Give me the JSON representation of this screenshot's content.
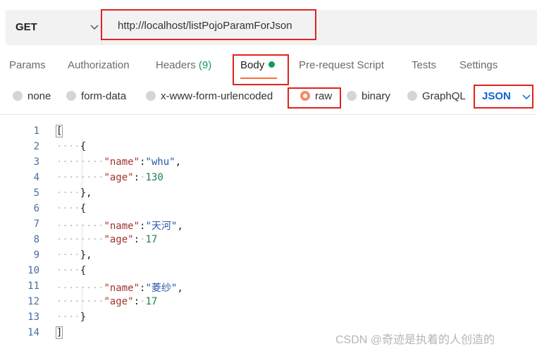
{
  "request": {
    "method": "GET",
    "url": "http://localhost/listPojoParamForJson"
  },
  "tabs": [
    {
      "label": "Params"
    },
    {
      "label": "Authorization"
    },
    {
      "label": "Headers",
      "count": "(9)"
    },
    {
      "label": "Body"
    },
    {
      "label": "Pre-request Script"
    },
    {
      "label": "Tests"
    },
    {
      "label": "Settings"
    }
  ],
  "body_types": [
    {
      "label": "none"
    },
    {
      "label": "form-data"
    },
    {
      "label": "x-www-form-urlencoded"
    },
    {
      "label": "raw"
    },
    {
      "label": "binary"
    },
    {
      "label": "GraphQL"
    }
  ],
  "format": "JSON",
  "code_lines": [
    "1",
    "2",
    "3",
    "4",
    "5",
    "6",
    "7",
    "8",
    "9",
    "10",
    "11",
    "12",
    "13",
    "14"
  ],
  "json_items": [
    {
      "name_key": "\"name\"",
      "name_value": "\"whu\"",
      "age_key": "\"age\"",
      "age_value": "130"
    },
    {
      "name_key": "\"name\"",
      "name_value": "\"天河\"",
      "age_key": "\"age\"",
      "age_value": "17"
    },
    {
      "name_key": "\"name\"",
      "name_value": "\"菱纱\"",
      "age_key": "\"age\"",
      "age_value": "17"
    }
  ],
  "watermark": "CSDN @奇迹是执着的人创造的",
  "colors": {
    "accent": "#ff6c37",
    "active_dot": "#0f9d58",
    "format": "#0b66d0",
    "highlight_box": "#e0231f"
  }
}
